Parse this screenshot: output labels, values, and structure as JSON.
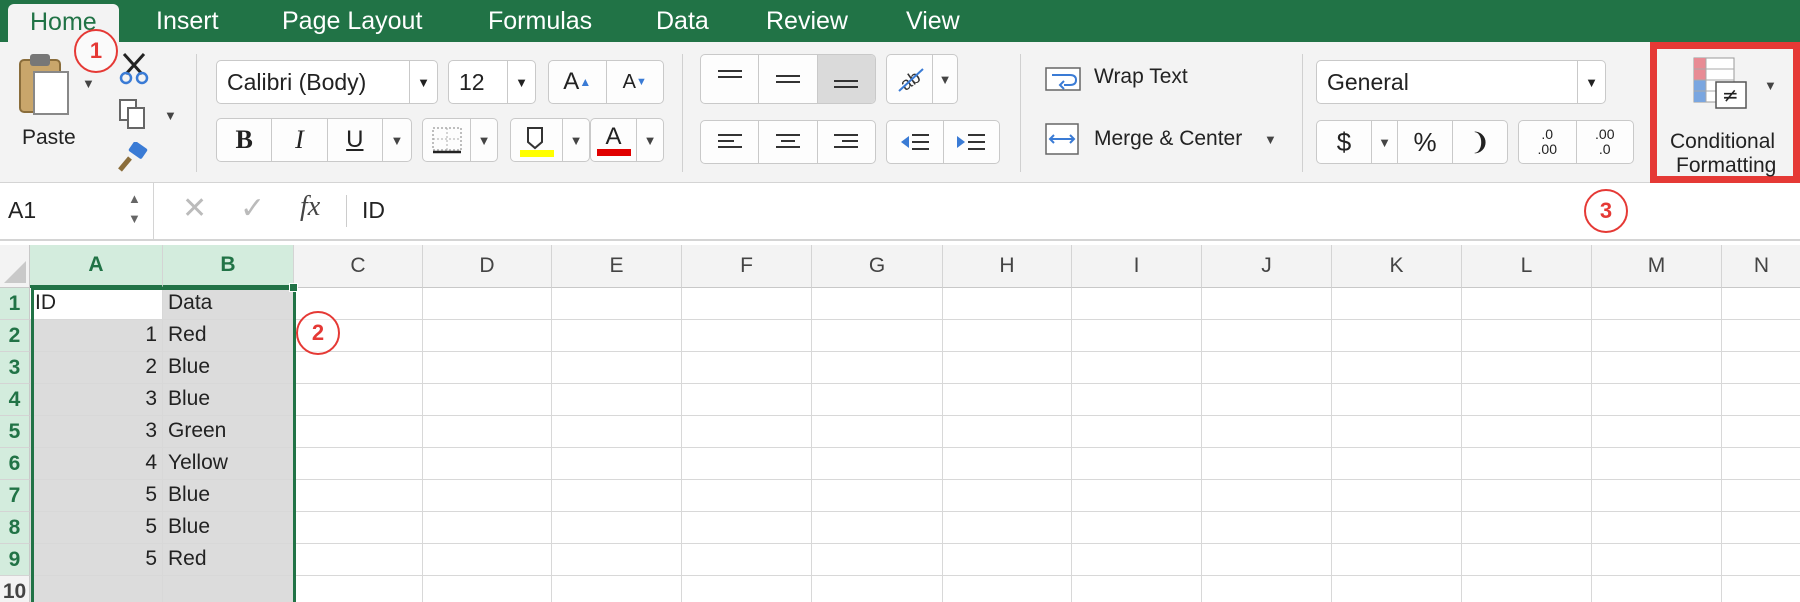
{
  "tabs": [
    "Home",
    "Insert",
    "Page Layout",
    "Formulas",
    "Data",
    "Review",
    "View"
  ],
  "clipboard": {
    "paste_label": "Paste"
  },
  "font": {
    "name": "Calibri (Body)",
    "size": "12",
    "grow_label": "A",
    "shrink_label": "A",
    "bold": "B",
    "italic": "I",
    "underline": "U",
    "font_color_label": "A"
  },
  "alignment": {
    "wrap_text": "Wrap Text",
    "merge_center": "Merge & Center"
  },
  "number": {
    "format": "General",
    "currency": "$",
    "percent": "%",
    "comma": "❩",
    "increase_decimal_top": ".0",
    "increase_decimal_bottom": ".00",
    "decrease_decimal_top": ".00",
    "decrease_decimal_bottom": ".0"
  },
  "conditional_formatting": {
    "line1": "Conditional",
    "line2": "Formatting"
  },
  "formula_bar": {
    "name_box": "A1",
    "fx": "fx",
    "content": "ID"
  },
  "markers": [
    "1",
    "2",
    "3"
  ],
  "columns": [
    "A",
    "B",
    "C",
    "D",
    "E",
    "F",
    "G",
    "H",
    "I",
    "J",
    "K",
    "L",
    "M",
    "N"
  ],
  "rows": [
    "1",
    "2",
    "3",
    "4",
    "5",
    "6",
    "7",
    "8",
    "9",
    "10"
  ],
  "table": [
    [
      "ID",
      "Data"
    ],
    [
      "1",
      "Red"
    ],
    [
      "2",
      "Blue"
    ],
    [
      "3",
      "Blue"
    ],
    [
      "3",
      "Green"
    ],
    [
      "4",
      "Yellow"
    ],
    [
      "5",
      "Blue"
    ],
    [
      "5",
      "Blue"
    ],
    [
      "5",
      "Red"
    ],
    [
      "",
      ""
    ]
  ],
  "colors": {
    "accent": "#217346",
    "highlight": "#e53935",
    "fill_yellow": "#ffff00",
    "font_red": "#e00000"
  }
}
